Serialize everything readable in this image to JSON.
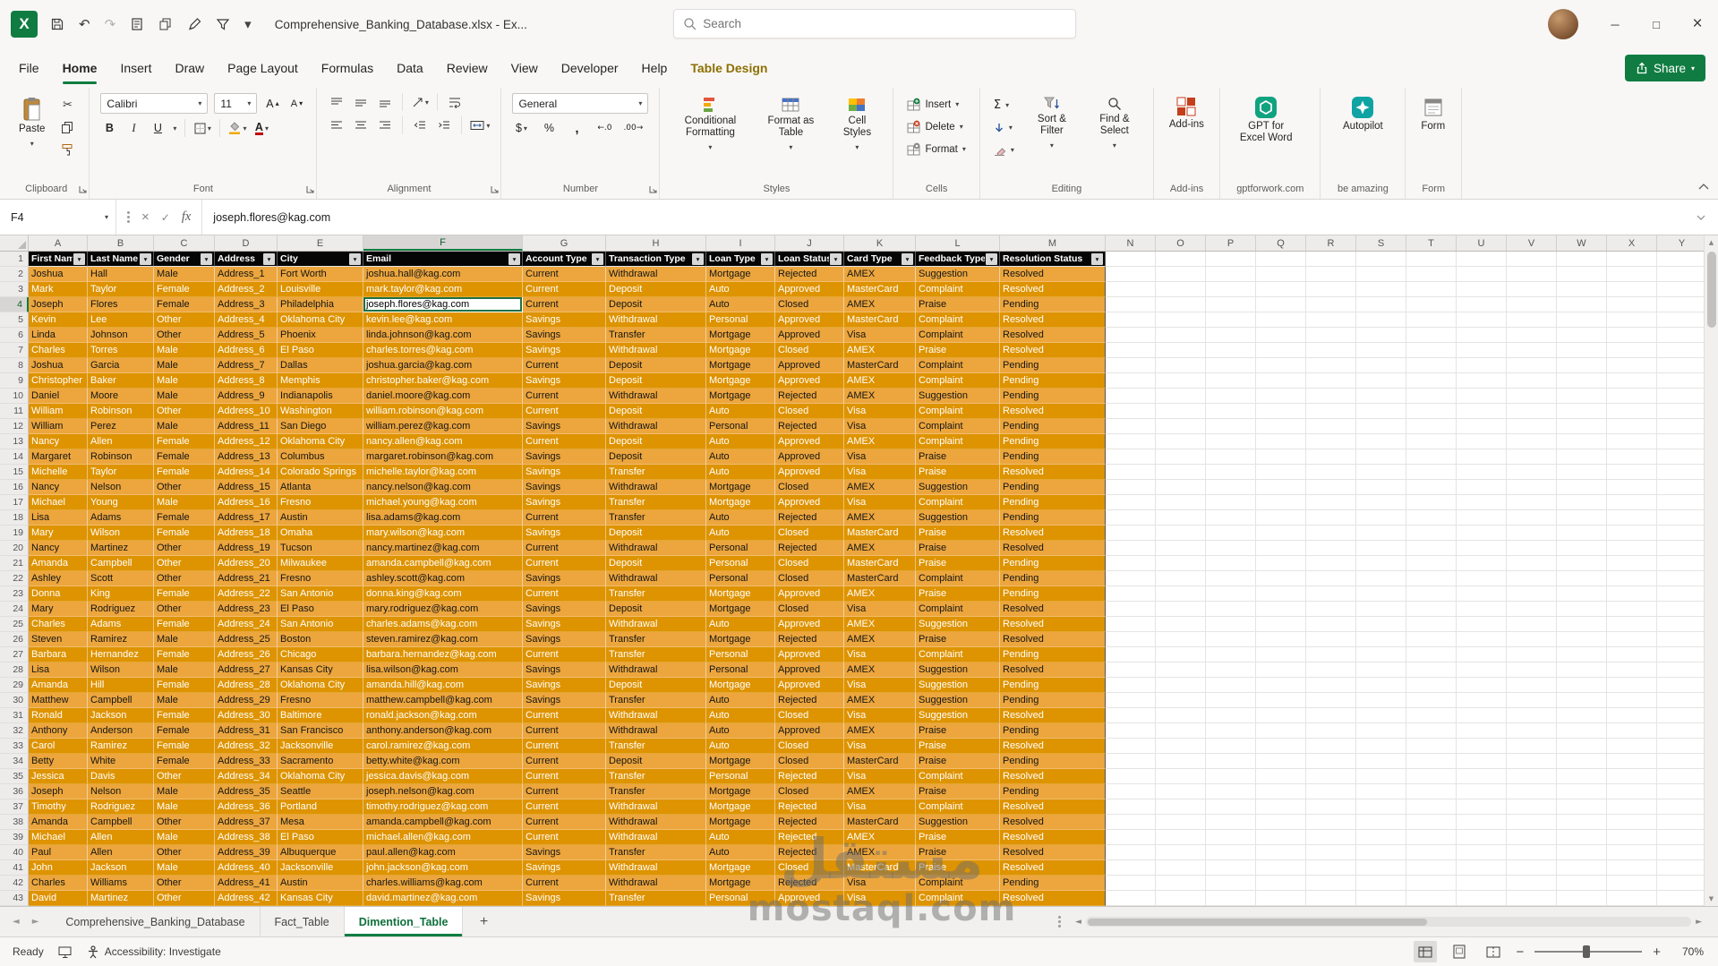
{
  "theme": {
    "excel_green": "#107C41",
    "band_light": "#ECA63D",
    "band_dark": "#DE9300",
    "table_header_bg": "#000000"
  },
  "window": {
    "title": "Comprehensive_Banking_Database.xlsx -  Ex...",
    "search_placeholder": "Search"
  },
  "menu": {
    "tabs": [
      "File",
      "Home",
      "Insert",
      "Draw",
      "Page Layout",
      "Formulas",
      "Data",
      "Review",
      "View",
      "Developer",
      "Help",
      "Table Design"
    ],
    "active_tab": "Home",
    "contextual_tab": "Table Design",
    "share_label": "Share"
  },
  "ribbon": {
    "clipboard": {
      "group": "Clipboard",
      "paste": "Paste"
    },
    "font": {
      "group": "Font",
      "name": "Calibri",
      "size": "11"
    },
    "alignment": {
      "group": "Alignment"
    },
    "number": {
      "group": "Number",
      "format": "General"
    },
    "styles": {
      "group": "Styles",
      "conditional": "Conditional Formatting",
      "as_table": "Format as Table",
      "cell_styles": "Cell Styles"
    },
    "cells": {
      "group": "Cells",
      "insert": "Insert",
      "delete": "Delete",
      "format": "Format"
    },
    "editing": {
      "group": "Editing",
      "sort_filter": "Sort & Filter",
      "find_select": "Find & Select"
    },
    "addins": {
      "group": "Add-ins",
      "label": "Add-ins"
    },
    "gpt": {
      "group": "gptforwork.com",
      "label": "GPT for Excel Word"
    },
    "autopilot": {
      "group": "be amazing",
      "label": "Autopilot"
    },
    "form": {
      "group": "Form",
      "label": "Form"
    }
  },
  "formula_bar": {
    "name_box": "F4",
    "value": "joseph.flores@kag.com"
  },
  "grid": {
    "col_letters": [
      "A",
      "B",
      "C",
      "D",
      "E",
      "F",
      "G",
      "H",
      "I",
      "J",
      "K",
      "L",
      "M",
      "N",
      "O",
      "P",
      "Q",
      "R",
      "S",
      "T",
      "U",
      "V",
      "W",
      "X",
      "Y"
    ],
    "active_col": "F",
    "active_row": 4
  },
  "table": {
    "headers": [
      "First Name",
      "Last Name",
      "Gender",
      "Address",
      "City",
      "Email",
      "Account Type",
      "Transaction Type",
      "Loan Type",
      "Loan Status",
      "Card Type",
      "Feedback Type",
      "Resolution Status"
    ],
    "rows": [
      [
        "Joshua",
        "Hall",
        "Male",
        "Address_1",
        "Fort Worth",
        "joshua.hall@kag.com",
        "Current",
        "Withdrawal",
        "Mortgage",
        "Rejected",
        "AMEX",
        "Suggestion",
        "Resolved"
      ],
      [
        "Mark",
        "Taylor",
        "Female",
        "Address_2",
        "Louisville",
        "mark.taylor@kag.com",
        "Current",
        "Deposit",
        "Auto",
        "Approved",
        "MasterCard",
        "Complaint",
        "Resolved"
      ],
      [
        "Joseph",
        "Flores",
        "Female",
        "Address_3",
        "Philadelphia",
        "joseph.flores@kag.com",
        "Current",
        "Deposit",
        "Auto",
        "Closed",
        "AMEX",
        "Praise",
        "Pending"
      ],
      [
        "Kevin",
        "Lee",
        "Other",
        "Address_4",
        "Oklahoma City",
        "kevin.lee@kag.com",
        "Savings",
        "Withdrawal",
        "Personal",
        "Approved",
        "MasterCard",
        "Complaint",
        "Resolved"
      ],
      [
        "Linda",
        "Johnson",
        "Other",
        "Address_5",
        "Phoenix",
        "linda.johnson@kag.com",
        "Savings",
        "Transfer",
        "Mortgage",
        "Approved",
        "Visa",
        "Complaint",
        "Resolved"
      ],
      [
        "Charles",
        "Torres",
        "Male",
        "Address_6",
        "El Paso",
        "charles.torres@kag.com",
        "Savings",
        "Withdrawal",
        "Mortgage",
        "Closed",
        "AMEX",
        "Praise",
        "Resolved"
      ],
      [
        "Joshua",
        "Garcia",
        "Male",
        "Address_7",
        "Dallas",
        "joshua.garcia@kag.com",
        "Current",
        "Deposit",
        "Mortgage",
        "Approved",
        "MasterCard",
        "Complaint",
        "Pending"
      ],
      [
        "Christopher",
        "Baker",
        "Male",
        "Address_8",
        "Memphis",
        "christopher.baker@kag.com",
        "Savings",
        "Deposit",
        "Mortgage",
        "Approved",
        "AMEX",
        "Complaint",
        "Pending"
      ],
      [
        "Daniel",
        "Moore",
        "Male",
        "Address_9",
        "Indianapolis",
        "daniel.moore@kag.com",
        "Current",
        "Withdrawal",
        "Mortgage",
        "Rejected",
        "AMEX",
        "Suggestion",
        "Pending"
      ],
      [
        "William",
        "Robinson",
        "Other",
        "Address_10",
        "Washington",
        "william.robinson@kag.com",
        "Current",
        "Deposit",
        "Auto",
        "Closed",
        "Visa",
        "Complaint",
        "Resolved"
      ],
      [
        "William",
        "Perez",
        "Male",
        "Address_11",
        "San Diego",
        "william.perez@kag.com",
        "Savings",
        "Withdrawal",
        "Personal",
        "Rejected",
        "Visa",
        "Complaint",
        "Pending"
      ],
      [
        "Nancy",
        "Allen",
        "Female",
        "Address_12",
        "Oklahoma City",
        "nancy.allen@kag.com",
        "Current",
        "Deposit",
        "Auto",
        "Approved",
        "AMEX",
        "Complaint",
        "Pending"
      ],
      [
        "Margaret",
        "Robinson",
        "Female",
        "Address_13",
        "Columbus",
        "margaret.robinson@kag.com",
        "Savings",
        "Deposit",
        "Auto",
        "Approved",
        "Visa",
        "Praise",
        "Pending"
      ],
      [
        "Michelle",
        "Taylor",
        "Female",
        "Address_14",
        "Colorado Springs",
        "michelle.taylor@kag.com",
        "Savings",
        "Transfer",
        "Auto",
        "Approved",
        "Visa",
        "Praise",
        "Resolved"
      ],
      [
        "Nancy",
        "Nelson",
        "Other",
        "Address_15",
        "Atlanta",
        "nancy.nelson@kag.com",
        "Savings",
        "Withdrawal",
        "Mortgage",
        "Closed",
        "AMEX",
        "Suggestion",
        "Pending"
      ],
      [
        "Michael",
        "Young",
        "Male",
        "Address_16",
        "Fresno",
        "michael.young@kag.com",
        "Savings",
        "Transfer",
        "Mortgage",
        "Approved",
        "Visa",
        "Complaint",
        "Pending"
      ],
      [
        "Lisa",
        "Adams",
        "Female",
        "Address_17",
        "Austin",
        "lisa.adams@kag.com",
        "Current",
        "Transfer",
        "Auto",
        "Rejected",
        "AMEX",
        "Suggestion",
        "Pending"
      ],
      [
        "Mary",
        "Wilson",
        "Female",
        "Address_18",
        "Omaha",
        "mary.wilson@kag.com",
        "Savings",
        "Deposit",
        "Auto",
        "Closed",
        "MasterCard",
        "Praise",
        "Resolved"
      ],
      [
        "Nancy",
        "Martinez",
        "Other",
        "Address_19",
        "Tucson",
        "nancy.martinez@kag.com",
        "Current",
        "Withdrawal",
        "Personal",
        "Rejected",
        "AMEX",
        "Praise",
        "Resolved"
      ],
      [
        "Amanda",
        "Campbell",
        "Other",
        "Address_20",
        "Milwaukee",
        "amanda.campbell@kag.com",
        "Current",
        "Deposit",
        "Personal",
        "Closed",
        "MasterCard",
        "Praise",
        "Pending"
      ],
      [
        "Ashley",
        "Scott",
        "Other",
        "Address_21",
        "Fresno",
        "ashley.scott@kag.com",
        "Savings",
        "Withdrawal",
        "Personal",
        "Closed",
        "MasterCard",
        "Complaint",
        "Pending"
      ],
      [
        "Donna",
        "King",
        "Female",
        "Address_22",
        "San Antonio",
        "donna.king@kag.com",
        "Current",
        "Transfer",
        "Mortgage",
        "Approved",
        "AMEX",
        "Praise",
        "Pending"
      ],
      [
        "Mary",
        "Rodriguez",
        "Other",
        "Address_23",
        "El Paso",
        "mary.rodriguez@kag.com",
        "Savings",
        "Deposit",
        "Mortgage",
        "Closed",
        "Visa",
        "Complaint",
        "Resolved"
      ],
      [
        "Charles",
        "Adams",
        "Female",
        "Address_24",
        "San Antonio",
        "charles.adams@kag.com",
        "Savings",
        "Withdrawal",
        "Auto",
        "Approved",
        "AMEX",
        "Suggestion",
        "Resolved"
      ],
      [
        "Steven",
        "Ramirez",
        "Male",
        "Address_25",
        "Boston",
        "steven.ramirez@kag.com",
        "Savings",
        "Transfer",
        "Mortgage",
        "Rejected",
        "AMEX",
        "Praise",
        "Resolved"
      ],
      [
        "Barbara",
        "Hernandez",
        "Female",
        "Address_26",
        "Chicago",
        "barbara.hernandez@kag.com",
        "Current",
        "Transfer",
        "Personal",
        "Approved",
        "Visa",
        "Complaint",
        "Pending"
      ],
      [
        "Lisa",
        "Wilson",
        "Male",
        "Address_27",
        "Kansas City",
        "lisa.wilson@kag.com",
        "Savings",
        "Withdrawal",
        "Personal",
        "Approved",
        "AMEX",
        "Suggestion",
        "Resolved"
      ],
      [
        "Amanda",
        "Hill",
        "Female",
        "Address_28",
        "Oklahoma City",
        "amanda.hill@kag.com",
        "Savings",
        "Deposit",
        "Mortgage",
        "Approved",
        "Visa",
        "Suggestion",
        "Pending"
      ],
      [
        "Matthew",
        "Campbell",
        "Male",
        "Address_29",
        "Fresno",
        "matthew.campbell@kag.com",
        "Savings",
        "Transfer",
        "Auto",
        "Rejected",
        "AMEX",
        "Suggestion",
        "Pending"
      ],
      [
        "Ronald",
        "Jackson",
        "Female",
        "Address_30",
        "Baltimore",
        "ronald.jackson@kag.com",
        "Current",
        "Withdrawal",
        "Auto",
        "Closed",
        "Visa",
        "Suggestion",
        "Resolved"
      ],
      [
        "Anthony",
        "Anderson",
        "Female",
        "Address_31",
        "San Francisco",
        "anthony.anderson@kag.com",
        "Current",
        "Withdrawal",
        "Auto",
        "Approved",
        "AMEX",
        "Praise",
        "Pending"
      ],
      [
        "Carol",
        "Ramirez",
        "Female",
        "Address_32",
        "Jacksonville",
        "carol.ramirez@kag.com",
        "Current",
        "Transfer",
        "Auto",
        "Closed",
        "Visa",
        "Praise",
        "Resolved"
      ],
      [
        "Betty",
        "White",
        "Female",
        "Address_33",
        "Sacramento",
        "betty.white@kag.com",
        "Current",
        "Deposit",
        "Mortgage",
        "Closed",
        "MasterCard",
        "Praise",
        "Pending"
      ],
      [
        "Jessica",
        "Davis",
        "Other",
        "Address_34",
        "Oklahoma City",
        "jessica.davis@kag.com",
        "Current",
        "Transfer",
        "Personal",
        "Rejected",
        "Visa",
        "Complaint",
        "Resolved"
      ],
      [
        "Joseph",
        "Nelson",
        "Male",
        "Address_35",
        "Seattle",
        "joseph.nelson@kag.com",
        "Current",
        "Transfer",
        "Mortgage",
        "Closed",
        "AMEX",
        "Praise",
        "Pending"
      ],
      [
        "Timothy",
        "Rodriguez",
        "Male",
        "Address_36",
        "Portland",
        "timothy.rodriguez@kag.com",
        "Current",
        "Withdrawal",
        "Mortgage",
        "Rejected",
        "Visa",
        "Complaint",
        "Resolved"
      ],
      [
        "Amanda",
        "Campbell",
        "Other",
        "Address_37",
        "Mesa",
        "amanda.campbell@kag.com",
        "Current",
        "Withdrawal",
        "Mortgage",
        "Rejected",
        "MasterCard",
        "Suggestion",
        "Resolved"
      ],
      [
        "Michael",
        "Allen",
        "Male",
        "Address_38",
        "El Paso",
        "michael.allen@kag.com",
        "Current",
        "Withdrawal",
        "Auto",
        "Rejected",
        "AMEX",
        "Praise",
        "Resolved"
      ],
      [
        "Paul",
        "Allen",
        "Other",
        "Address_39",
        "Albuquerque",
        "paul.allen@kag.com",
        "Savings",
        "Transfer",
        "Auto",
        "Rejected",
        "AMEX",
        "Praise",
        "Resolved"
      ],
      [
        "John",
        "Jackson",
        "Male",
        "Address_40",
        "Jacksonville",
        "john.jackson@kag.com",
        "Savings",
        "Withdrawal",
        "Mortgage",
        "Closed",
        "MasterCard",
        "Praise",
        "Resolved"
      ],
      [
        "Charles",
        "Williams",
        "Other",
        "Address_41",
        "Austin",
        "charles.williams@kag.com",
        "Current",
        "Withdrawal",
        "Mortgage",
        "Rejected",
        "Visa",
        "Complaint",
        "Pending"
      ],
      [
        "David",
        "Martinez",
        "Other",
        "Address_42",
        "Kansas City",
        "david.martinez@kag.com",
        "Savings",
        "Transfer",
        "Personal",
        "Approved",
        "Visa",
        "Complaint",
        "Resolved"
      ]
    ]
  },
  "sheets": {
    "tabs": [
      "Comprehensive_Banking_Database",
      "Fact_Table",
      "Dimention_Table"
    ],
    "active": "Dimention_Table"
  },
  "status": {
    "mode": "Ready",
    "accessibility": "Accessibility: Investigate",
    "zoom": "70%"
  },
  "watermark": {
    "line1": "مستقل",
    "line2": "mostaql.com"
  }
}
